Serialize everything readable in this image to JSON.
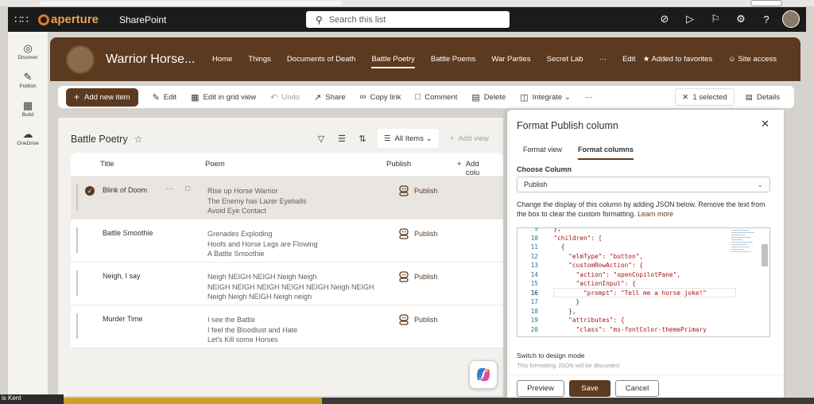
{
  "suite": {
    "brand": "aperture",
    "app_name": "SharePoint",
    "search_placeholder": "Search this list"
  },
  "appbar": {
    "items": [
      {
        "label": "Discover",
        "icon": "compass-icon"
      },
      {
        "label": "Publish",
        "icon": "pen-icon"
      },
      {
        "label": "Build",
        "icon": "grid-icon"
      },
      {
        "label": "OneDrive",
        "icon": "cloud-icon"
      }
    ]
  },
  "site": {
    "title": "Warrior Horse...",
    "nav": [
      "Home",
      "Things",
      "Documents of Death",
      "Battle Poetry",
      "Battle Poems",
      "War Parties",
      "Secret Lab",
      "···",
      "Edit"
    ],
    "active_nav": "Battle Poetry",
    "favorite_label": "Added to favorites",
    "site_access_label": "Site access"
  },
  "commands": {
    "new_item": "Add new item",
    "edit": "Edit",
    "grid": "Edit in grid view",
    "undo": "Undo",
    "share": "Share",
    "copy_link": "Copy link",
    "comment": "Comment",
    "delete": "Delete",
    "integrate": "Integrate",
    "more": "···",
    "selected": "1 selected",
    "details": "Details"
  },
  "list": {
    "title": "Battle Poetry",
    "view_name": "All Items",
    "add_view": "Add view",
    "columns": {
      "title": "Title",
      "poem": "Poem",
      "publish": "Publish",
      "add_column": "Add colu"
    },
    "rows": [
      {
        "title": "Blink of Doom",
        "poem": [
          "Rise up Horse Warrior",
          "The Enemy has Lazer Eyeballs",
          "Avoid Eye Contact"
        ],
        "publish": "Publish"
      },
      {
        "title": "Battle Smoothie",
        "poem": [
          "Grenades Exploding",
          "Hoofs and Horse Legs are Flowing",
          "A Battle Smoothie"
        ],
        "publish": "Publish"
      },
      {
        "title": "Neigh, I say",
        "poem": [
          "Neigh NEIGH NEIGH Neigh Neigh",
          "NEIGH NEIGH NEIGH NEIGH NEIGH Neigh NEIGH",
          "Neigh Neigh NEIGH Neigh neigh"
        ],
        "publish": "Publish"
      },
      {
        "title": "Murder Time",
        "poem": [
          "I see the Battle",
          "I feel the Bloodlust and Hate",
          "Let's Kill some Horses"
        ],
        "publish": "Publish"
      }
    ]
  },
  "panel": {
    "title": "Format Publish column",
    "tabs": [
      "Format view",
      "Format columns"
    ],
    "active_tab": "Format columns",
    "choose_label": "Choose Column",
    "choose_value": "Publish",
    "description": "Change the display of this column by adding JSON below. Remove the text from the box to clear the custom formatting.",
    "learn_more": "Learn more",
    "code": [
      {
        "n": "9",
        "text": "  },"
      },
      {
        "n": "10",
        "text": "  \"children\": ["
      },
      {
        "n": "11",
        "text": "    {"
      },
      {
        "n": "12",
        "text": "      \"elmType\": \"button\","
      },
      {
        "n": "13",
        "text": "      \"customRowAction\": {"
      },
      {
        "n": "14",
        "text": "        \"action\": \"openCopilotPane\","
      },
      {
        "n": "15",
        "text": "        \"actionInput\": {"
      },
      {
        "n": "16",
        "text": "          \"prompt\": \"Tell me a horse joke!\""
      },
      {
        "n": "17",
        "text": "        }"
      },
      {
        "n": "18",
        "text": "      },"
      },
      {
        "n": "19",
        "text": "      \"attributes\": {"
      },
      {
        "n": "20",
        "text": "        \"class\": \"ms-fontColor-themePrimary"
      }
    ],
    "switch_label": "Switch to design mode",
    "switch_note": "This formatting JSON will be discarded",
    "buttons": {
      "preview": "Preview",
      "save": "Save",
      "cancel": "Cancel"
    }
  },
  "user_tag": "is Kent",
  "colors": {
    "accent": "#5c3a1f",
    "suite_bg": "#1b1b1b"
  }
}
